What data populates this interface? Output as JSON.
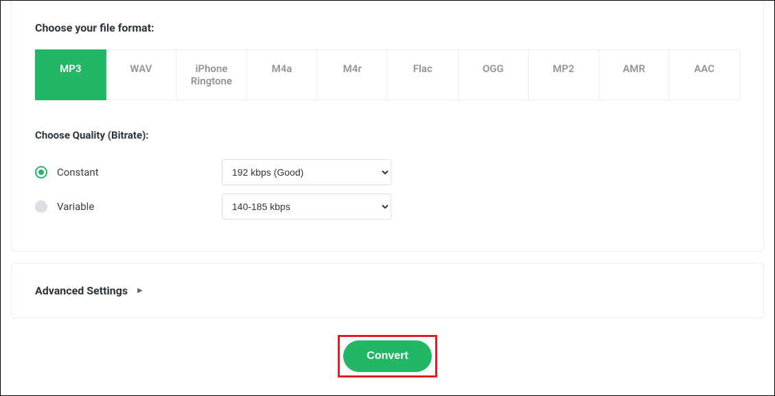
{
  "format": {
    "label": "Choose your file format:",
    "tabs": [
      "MP3",
      "WAV",
      "iPhone Ringtone",
      "M4a",
      "M4r",
      "Flac",
      "OGG",
      "MP2",
      "AMR",
      "AAC"
    ],
    "active": "MP3"
  },
  "quality": {
    "label": "Choose Quality (Bitrate):",
    "constant": {
      "label": "Constant",
      "selected": "192 kbps (Good)"
    },
    "variable": {
      "label": "Variable",
      "selected": "140-185 kbps"
    },
    "checked": "constant"
  },
  "advanced": {
    "label": "Advanced Settings"
  },
  "convert": {
    "label": "Convert"
  }
}
